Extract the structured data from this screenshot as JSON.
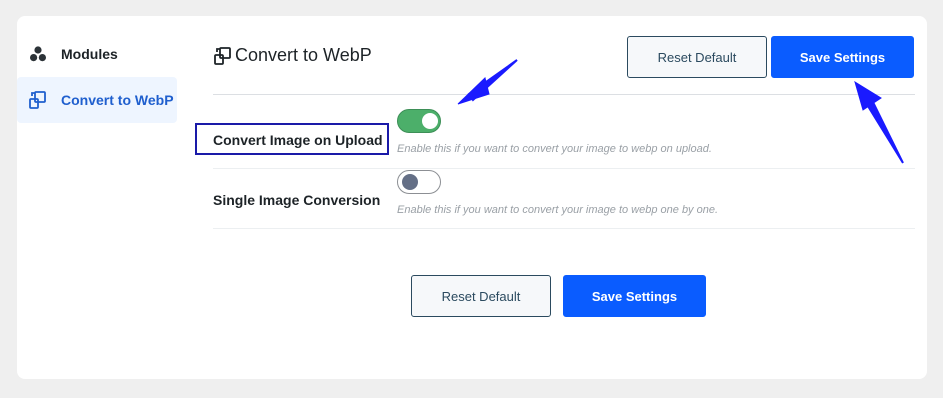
{
  "sidebar": {
    "items": [
      {
        "label": "Modules",
        "icon": "modules-icon"
      },
      {
        "label": "Convert to WebP",
        "icon": "convert-icon"
      }
    ]
  },
  "header": {
    "title": "Convert to WebP",
    "reset_label": "Reset Default",
    "save_label": "Save Settings"
  },
  "settings": [
    {
      "label": "Convert Image on Upload",
      "enabled": true,
      "help": "Enable this if you want to convert your image to webp on upload."
    },
    {
      "label": "Single Image Conversion",
      "enabled": false,
      "help": "Enable this if you want to convert your image to webp one by one."
    }
  ],
  "footer": {
    "reset_label": "Reset Default",
    "save_label": "Save Settings"
  },
  "colors": {
    "accent": "#0a5cff",
    "toggle_on": "#4caf6a",
    "annotation": "#1a1aff"
  }
}
